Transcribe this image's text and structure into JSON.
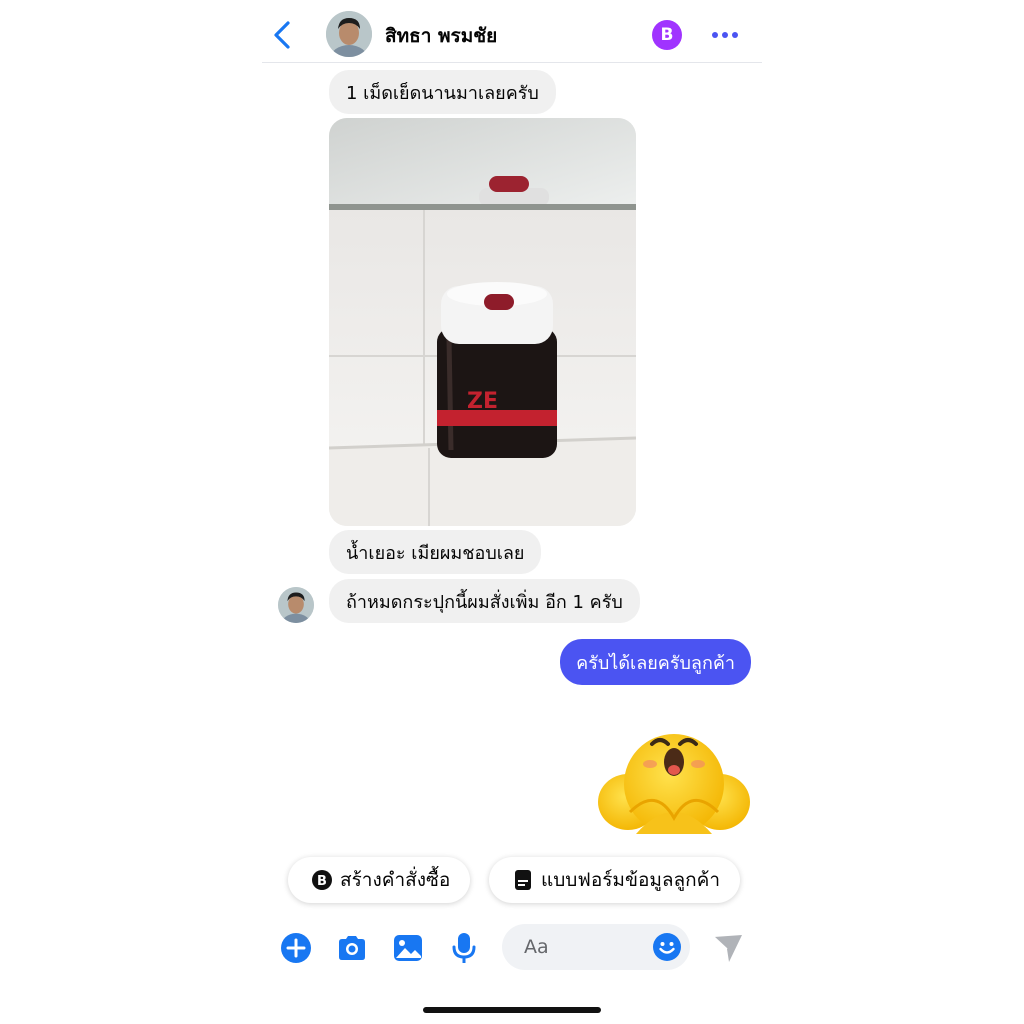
{
  "header": {
    "contact_name": "สิทธา พรมชัย",
    "badge_symbol": "B"
  },
  "messages": [
    {
      "side": "incoming",
      "text": "1 เม็ดเย็ดนานมาเลยครับ"
    },
    {
      "side": "incoming",
      "type": "photo",
      "photo_text": "ZE"
    },
    {
      "side": "incoming",
      "text": "น้ำเยอะ เมียผมชอบเลย"
    },
    {
      "side": "incoming",
      "text": "ถ้าหมดกระปุกนี้ผมสั่งเพิ่ม อีก 1 ครับ"
    },
    {
      "side": "outgoing",
      "text": "ครับได้เลยครับลูกค้า"
    },
    {
      "side": "outgoing",
      "type": "sticker"
    }
  ],
  "quick_replies": [
    {
      "icon": "baht-circle-icon",
      "label": "สร้างคำสั่งซื้อ"
    },
    {
      "icon": "form-icon",
      "label": "แบบฟอร์มข้อมูลลูกค้า"
    }
  ],
  "composer": {
    "placeholder": "Aa"
  },
  "colors": {
    "accent": "#4b54f2",
    "icon_blue": "#1877f2",
    "badge_purple": "#a033ff",
    "incoming_bubble": "#f0f0f0"
  }
}
